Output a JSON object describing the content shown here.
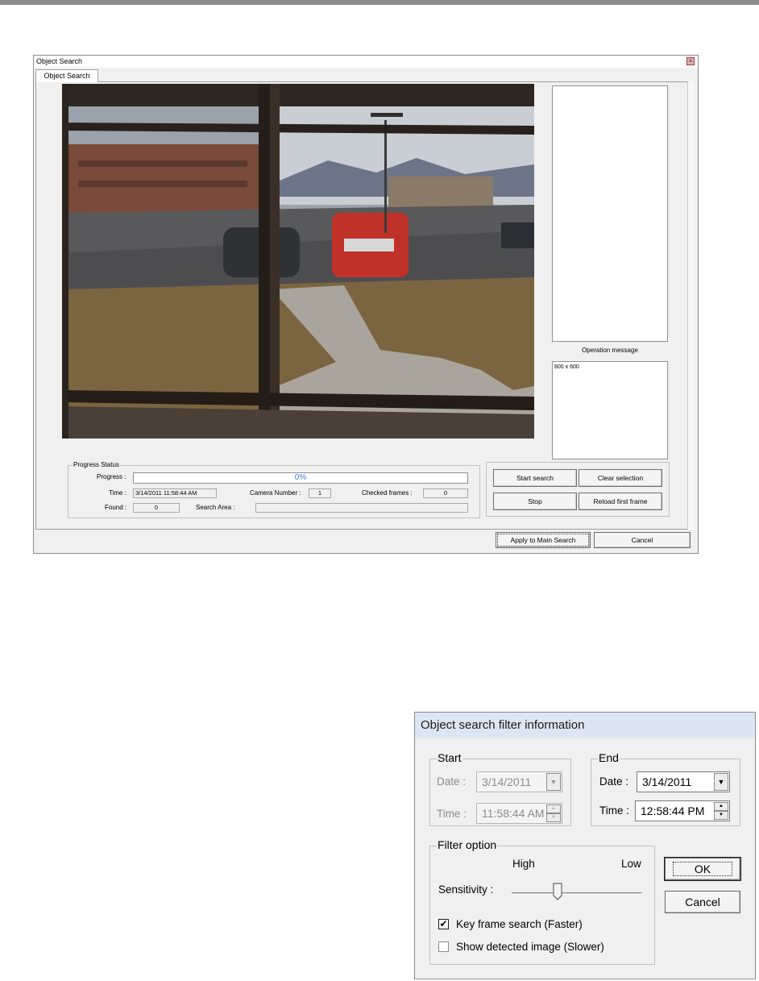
{
  "object_search": {
    "title": "Object Search",
    "tab": "Object Search",
    "operation_message_label": "Operation message",
    "operation_message": "800 x 600",
    "progress_group": {
      "title": "Progress Status",
      "progress_label": "Progress :",
      "progress_value": "0%",
      "time_label": "Time :",
      "time_value": "3/14/2011 11:58:44 AM",
      "camera_label": "Camera Number :",
      "camera_value": "1",
      "checked_label": "Checked frames :",
      "checked_value": "0",
      "found_label": "Found :",
      "found_value": "0",
      "area_label": "Search Area :",
      "area_value": ""
    },
    "buttons": {
      "start": "Start search",
      "clear": "Clear selection",
      "stop": "Stop",
      "reload": "Reload first frame",
      "apply": "Apply to Main Search",
      "cancel": "Cancel"
    }
  },
  "filter_dialog": {
    "title": "Object search filter information",
    "start": {
      "title": "Start",
      "date_label": "Date :",
      "date_value": "3/14/2011",
      "time_label": "Time :",
      "time_value": "11:58:44 AM"
    },
    "end": {
      "title": "End",
      "date_label": "Date :",
      "date_value": "3/14/2011",
      "time_label": "Time :",
      "time_value": "12:58:44 PM"
    },
    "filter": {
      "title": "Filter option",
      "high": "High",
      "low": "Low",
      "sensitivity_label": "Sensitivity :",
      "sensitivity_level": 0.35,
      "keyframe_label": "Key frame search (Faster)",
      "keyframe_checked": true,
      "show_detected_label": "Show detected image (Slower)",
      "show_detected_checked": false
    },
    "ok": "OK",
    "cancel": "Cancel"
  },
  "icons": {
    "close": "close-icon",
    "dropdown": "chevron-down-icon",
    "spinner": "spinner-arrows-icon",
    "check": "checkmark-icon"
  }
}
